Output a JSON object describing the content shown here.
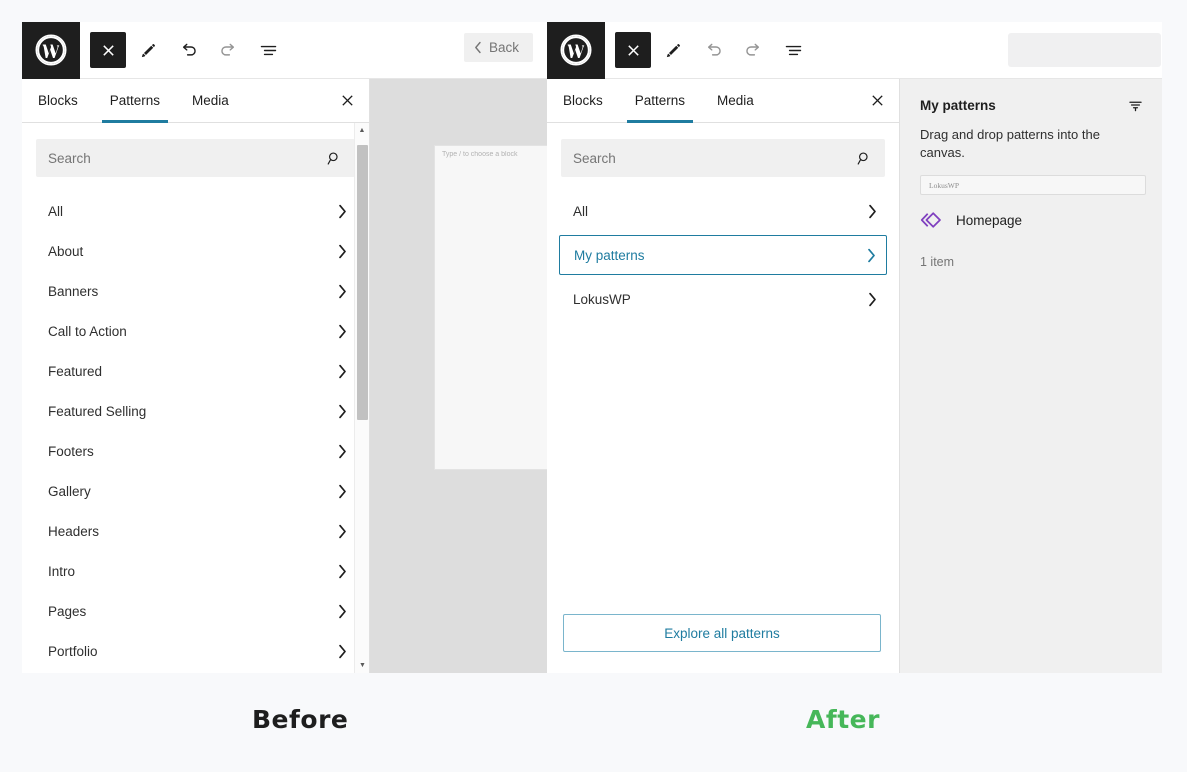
{
  "captions": {
    "before": "Before",
    "after": "After"
  },
  "before": {
    "toolbar": {
      "logo_icon": "wordpress-logo-icon",
      "close_icon": "close-icon",
      "edit_icon": "pencil-icon",
      "undo_icon": "undo-icon",
      "redo_icon": "redo-icon",
      "list_view_icon": "list-view-icon",
      "back_label": "Back",
      "back_chevron_icon": "chevron-left-icon"
    },
    "inserter": {
      "tabs": [
        {
          "label": "Blocks",
          "active": false
        },
        {
          "label": "Patterns",
          "active": true
        },
        {
          "label": "Media",
          "active": false
        }
      ],
      "close_icon": "close-icon",
      "search": {
        "placeholder": "Search",
        "value": "",
        "icon": "search-icon"
      },
      "categories": [
        "All",
        "About",
        "Banners",
        "Call to Action",
        "Featured",
        "Featured Selling",
        "Footers",
        "Gallery",
        "Headers",
        "Intro",
        "Pages",
        "Portfolio"
      ],
      "chevron_icon": "chevron-right-icon",
      "scrollbar": {
        "up_icon": "caret-up-icon",
        "down_icon": "caret-down-icon"
      }
    },
    "canvas": {
      "hint": "Type / to choose a block"
    }
  },
  "after": {
    "toolbar": {
      "logo_icon": "wordpress-logo-icon",
      "close_icon": "close-icon",
      "edit_icon": "pencil-icon",
      "undo_icon": "undo-icon",
      "redo_icon": "redo-icon",
      "list_view_icon": "list-view-icon"
    },
    "inserter": {
      "tabs": [
        {
          "label": "Blocks",
          "active": false
        },
        {
          "label": "Patterns",
          "active": true
        },
        {
          "label": "Media",
          "active": false
        }
      ],
      "close_icon": "close-icon",
      "search": {
        "placeholder": "Search",
        "value": "",
        "icon": "search-icon"
      },
      "categories": [
        {
          "label": "All",
          "selected": false
        },
        {
          "label": "My patterns",
          "selected": true
        },
        {
          "label": "LokusWP",
          "selected": false
        }
      ],
      "chevron_icon": "chevron-right-icon",
      "explore_label": "Explore all patterns"
    },
    "sidebar": {
      "title": "My patterns",
      "filter_icon": "filter-icon",
      "description": "Drag and drop patterns into the canvas.",
      "field_value": "LokusWP",
      "pattern": {
        "icon": "pattern-diamond-icon",
        "name": "Homepage"
      },
      "count": "1 item"
    }
  },
  "colors": {
    "accent": "#1f7ca0",
    "after_caption": "#46b759",
    "pattern_icon": "#7f3fbf",
    "dark": "#1e1e1e",
    "panel_bg": "#f0f0f0",
    "page_bg": "#f8f9fb"
  }
}
